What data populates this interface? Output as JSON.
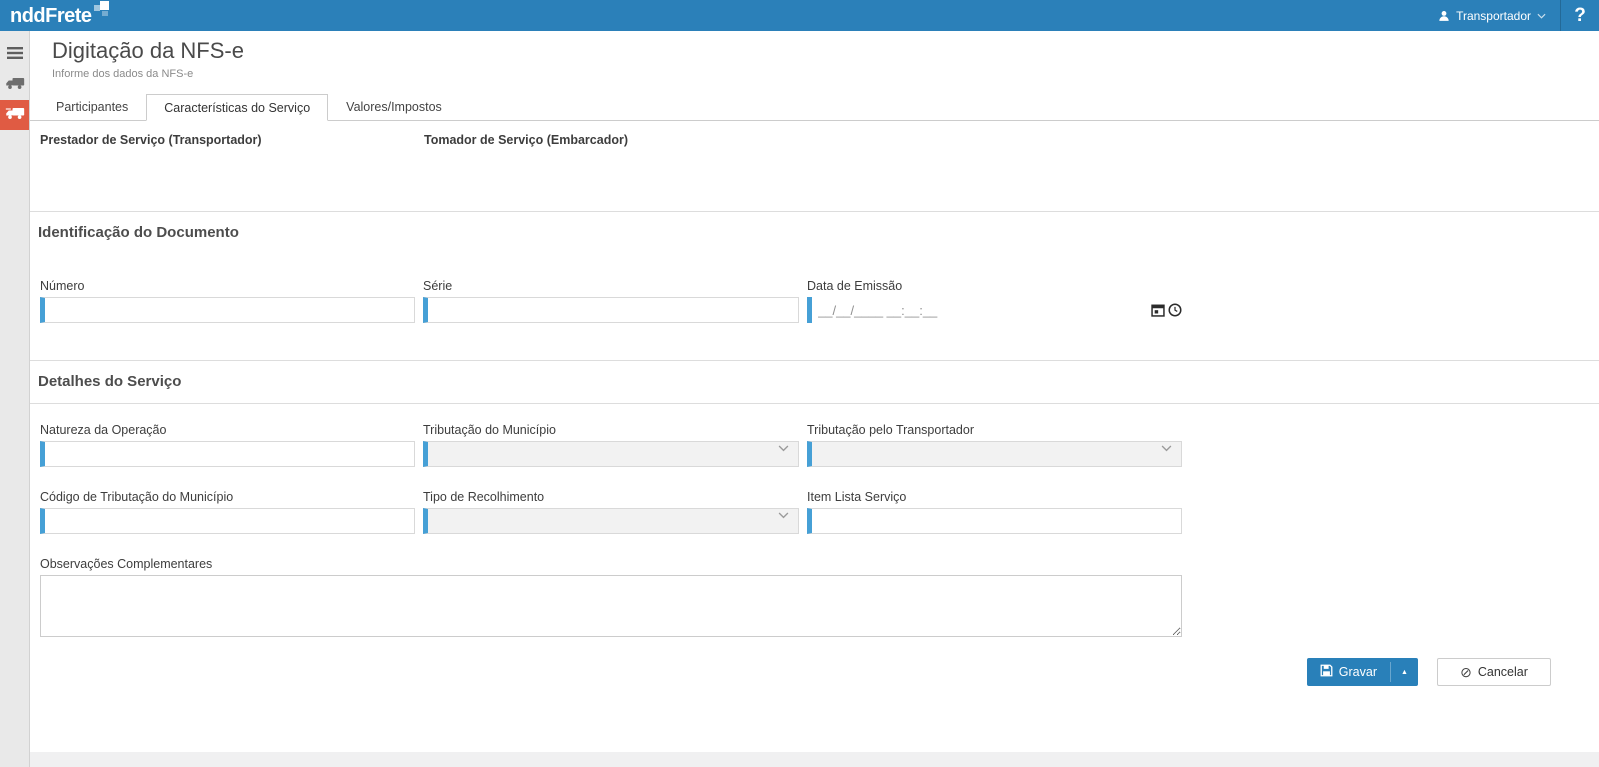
{
  "header": {
    "logo_text": "nddFrete",
    "user_label": "Transportador",
    "help_label": "?"
  },
  "page": {
    "title": "Digitação da NFS-e",
    "subtitle": "Informe dos dados da NFS-e"
  },
  "tabs": [
    {
      "label": "Participantes",
      "active": false
    },
    {
      "label": "Características do Serviço",
      "active": true
    },
    {
      "label": "Valores/Impostos",
      "active": false
    }
  ],
  "participants": {
    "prestador_label": "Prestador de Serviço (Transportador)",
    "tomador_label": "Tomador de Serviço (Embarcador)"
  },
  "identificacao": {
    "title": "Identificação do Documento",
    "numero_label": "Número",
    "numero_value": "",
    "serie_label": "Série",
    "serie_value": "",
    "data_emissao_label": "Data de Emissão",
    "data_emissao_placeholder": "__/__/____ __:__:__",
    "data_emissao_value": ""
  },
  "detalhes": {
    "title": "Detalhes do Serviço",
    "natureza_label": "Natureza da Operação",
    "natureza_value": "",
    "trib_municipio_label": "Tributação do Município",
    "trib_municipio_value": "",
    "trib_transportador_label": "Tributação pelo Transportador",
    "trib_transportador_value": "",
    "cod_trib_municipio_label": "Código de Tributação do Município",
    "cod_trib_municipio_value": "",
    "tipo_recolhimento_label": "Tipo de Recolhimento",
    "tipo_recolhimento_value": "",
    "item_lista_label": "Item Lista Serviço",
    "item_lista_value": "",
    "observacoes_label": "Observações Complementares",
    "observacoes_value": ""
  },
  "actions": {
    "gravar_label": "Gravar",
    "gravar_caret_glyph": "▲",
    "cancelar_label": "Cancelar",
    "cancelar_glyph": "⊘"
  },
  "icons": {
    "hamburger": "hamburger-menu-icon",
    "truck": "truck-icon",
    "truck_active": "truck-active-icon",
    "user": "user-icon",
    "chevron_down": "chevron-down-icon",
    "calendar": "calendar-icon",
    "clock": "clock-icon",
    "save": "save-floppy-icon",
    "cancel": "cancel-circle-slash-icon"
  },
  "colors": {
    "header_blue": "#2b80b9",
    "accent_blue": "#46a0d6",
    "active_item_red": "#e05b43",
    "button_blue": "#2980b9"
  }
}
